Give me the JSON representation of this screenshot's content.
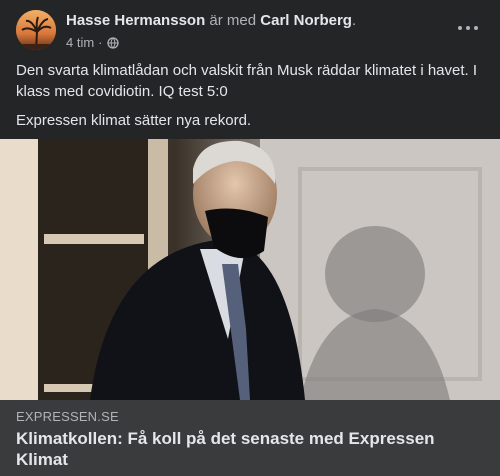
{
  "post": {
    "author": "Hasse Hermansson",
    "with_text": "är med",
    "tagged": "Carl Norberg",
    "period": ".",
    "time": "4 tim",
    "separator": "·",
    "privacy_icon": "globe-icon",
    "more_icon": "more-options-icon",
    "text_lines": [
      "Den svarta klimatlådan och valskit från Musk räddar klimatet i havet. I klass med covidiotin. IQ test 5:0",
      "Expressen klimat sätter nya rekord."
    ]
  },
  "link_preview": {
    "domain": "EXPRESSEN.SE",
    "title": "Klimatkollen: Få koll på det senaste med Expressen Klimat"
  },
  "colors": {
    "background": "#242526",
    "link_bar": "#3a3b3c",
    "text_primary": "#e4e6eb",
    "text_secondary": "#b0b3b8"
  }
}
